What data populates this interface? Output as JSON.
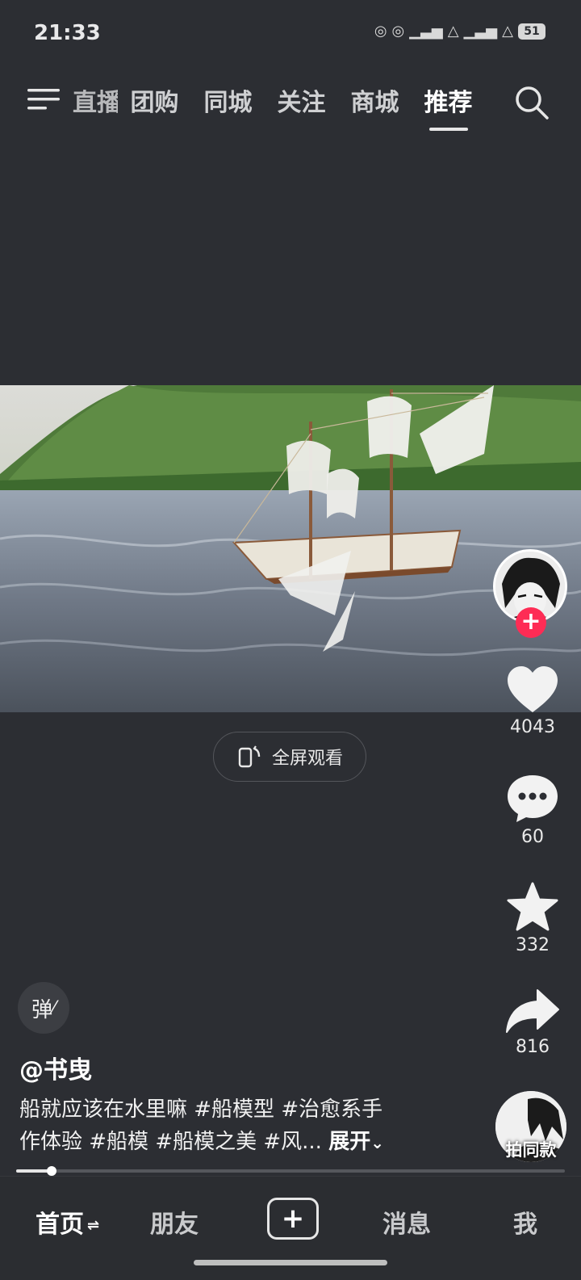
{
  "status_bar": {
    "time": "21:33",
    "battery": "51",
    "icons": [
      "nfc-icon",
      "nfc-icon",
      "signal-5g-icon",
      "wifi-icon",
      "signal-5g-icon",
      "wifi-icon"
    ]
  },
  "top_nav": {
    "tabs": [
      {
        "label": "直播",
        "partial": true
      },
      {
        "label": "团购"
      },
      {
        "label": "同城"
      },
      {
        "label": "关注"
      },
      {
        "label": "商城"
      },
      {
        "label": "推荐",
        "active": true
      }
    ]
  },
  "video": {
    "fullscreen_label": "全屏观看"
  },
  "actions": {
    "likes": "4043",
    "comments": "60",
    "favorites": "332",
    "shares": "816"
  },
  "danmu_label": "弹",
  "post": {
    "author": "@书曳",
    "caption_line1": "船就应该在水里嘛 #船模型 #治愈系手",
    "caption_line2": "作体验 #船模 #船模之美 #风... ",
    "expand_label": "展开"
  },
  "same_style_label": "拍同款",
  "progress": 0.064,
  "bottom_nav": {
    "home": "首页",
    "friends": "朋友",
    "messages": "消息",
    "me": "我"
  },
  "colors": {
    "background": "#2c2e33",
    "accent": "#fe2c55"
  }
}
